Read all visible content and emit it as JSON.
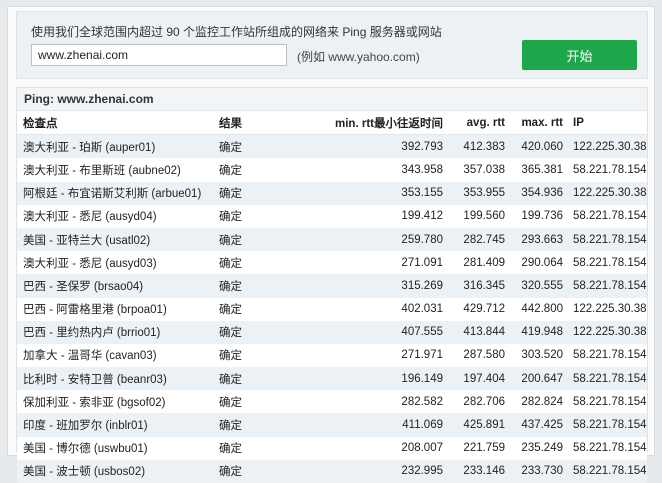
{
  "form": {
    "description": "使用我们全球范围内超过 90 个监控工作站所组成的网络来 Ping 服务器或网站",
    "host_value": "www.zhenai.com",
    "example_hint": "(例如 www.yahoo.com)",
    "start_label": "开始",
    "accent_color": "#1da64a"
  },
  "result": {
    "title": "Ping: www.zhenai.com",
    "columns": [
      "检查点",
      "结果",
      "min. rtt最小往返时间",
      "avg. rtt",
      "max. rtt",
      "IP"
    ],
    "rows": [
      {
        "checkpoint": "澳大利亚 - 珀斯 (auper01)",
        "result": "确定",
        "min": "392.793",
        "avg": "412.383",
        "max": "420.060",
        "ip": "122.225.30.38"
      },
      {
        "checkpoint": "澳大利亚 - 布里斯班 (aubne02)",
        "result": "确定",
        "min": "343.958",
        "avg": "357.038",
        "max": "365.381",
        "ip": "58.221.78.154"
      },
      {
        "checkpoint": "阿根廷 - 布宜诺斯艾利斯 (arbue01)",
        "result": "确定",
        "min": "353.155",
        "avg": "353.955",
        "max": "354.936",
        "ip": "122.225.30.38"
      },
      {
        "checkpoint": "澳大利亚 - 悉尼 (ausyd04)",
        "result": "确定",
        "min": "199.412",
        "avg": "199.560",
        "max": "199.736",
        "ip": "58.221.78.154"
      },
      {
        "checkpoint": "美国 - 亚特兰大 (usatl02)",
        "result": "确定",
        "min": "259.780",
        "avg": "282.745",
        "max": "293.663",
        "ip": "58.221.78.154"
      },
      {
        "checkpoint": "澳大利亚 - 悉尼 (ausyd03)",
        "result": "确定",
        "min": "271.091",
        "avg": "281.409",
        "max": "290.064",
        "ip": "58.221.78.154"
      },
      {
        "checkpoint": "巴西 - 圣保罗 (brsao04)",
        "result": "确定",
        "min": "315.269",
        "avg": "316.345",
        "max": "320.555",
        "ip": "58.221.78.154"
      },
      {
        "checkpoint": "巴西 - 阿雷格里港 (brpoa01)",
        "result": "确定",
        "min": "402.031",
        "avg": "429.712",
        "max": "442.800",
        "ip": "122.225.30.38"
      },
      {
        "checkpoint": "巴西 - 里约热内卢 (brrio01)",
        "result": "确定",
        "min": "407.555",
        "avg": "413.844",
        "max": "419.948",
        "ip": "122.225.30.38"
      },
      {
        "checkpoint": "加拿大 - 温哥华 (cavan03)",
        "result": "确定",
        "min": "271.971",
        "avg": "287.580",
        "max": "303.520",
        "ip": "58.221.78.154"
      },
      {
        "checkpoint": "比利时 - 安特卫普 (beanr03)",
        "result": "确定",
        "min": "196.149",
        "avg": "197.404",
        "max": "200.647",
        "ip": "58.221.78.154"
      },
      {
        "checkpoint": "保加利亚 - 索非亚 (bgsof02)",
        "result": "确定",
        "min": "282.582",
        "avg": "282.706",
        "max": "282.824",
        "ip": "58.221.78.154"
      },
      {
        "checkpoint": "印度 - 班加罗尔 (inblr01)",
        "result": "确定",
        "min": "411.069",
        "avg": "425.891",
        "max": "437.425",
        "ip": "58.221.78.154"
      },
      {
        "checkpoint": "美国 - 博尔德 (uswbu01)",
        "result": "确定",
        "min": "208.007",
        "avg": "221.759",
        "max": "235.249",
        "ip": "58.221.78.154"
      },
      {
        "checkpoint": "美国 - 波士顿 (usbos02)",
        "result": "确定",
        "min": "232.995",
        "avg": "233.146",
        "max": "233.730",
        "ip": "58.221.78.154"
      }
    ]
  }
}
